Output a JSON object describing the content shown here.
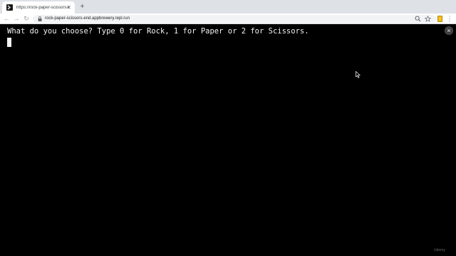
{
  "browser": {
    "tab_title": "https://rock-paper-scissors-end.appbrewery.repl.run",
    "url": "rock-paper-scissors-end.appbrewery.repl.run"
  },
  "terminal": {
    "prompt": "What do you choose? Type 0 for Rock, 1 for Paper or 2 for Scissors."
  },
  "watermark": "Udemy",
  "icons": {
    "favicon": "repl-icon",
    "tab_close": "close-icon",
    "new_tab": "plus-icon",
    "back": "arrow-left-icon",
    "forward": "arrow-right-icon",
    "reload": "reload-icon",
    "lock": "lock-icon",
    "zoom": "search-icon",
    "bookmark": "star-icon",
    "extension": "extension-icon",
    "menu": "kebab-menu-icon",
    "overlay_close": "close-circle-icon"
  },
  "colors": {
    "terminal_background": "#000000",
    "terminal_text": "#f2f2f2",
    "tabstrip": "#dee1e6",
    "extension_accent": "#f6c026"
  }
}
